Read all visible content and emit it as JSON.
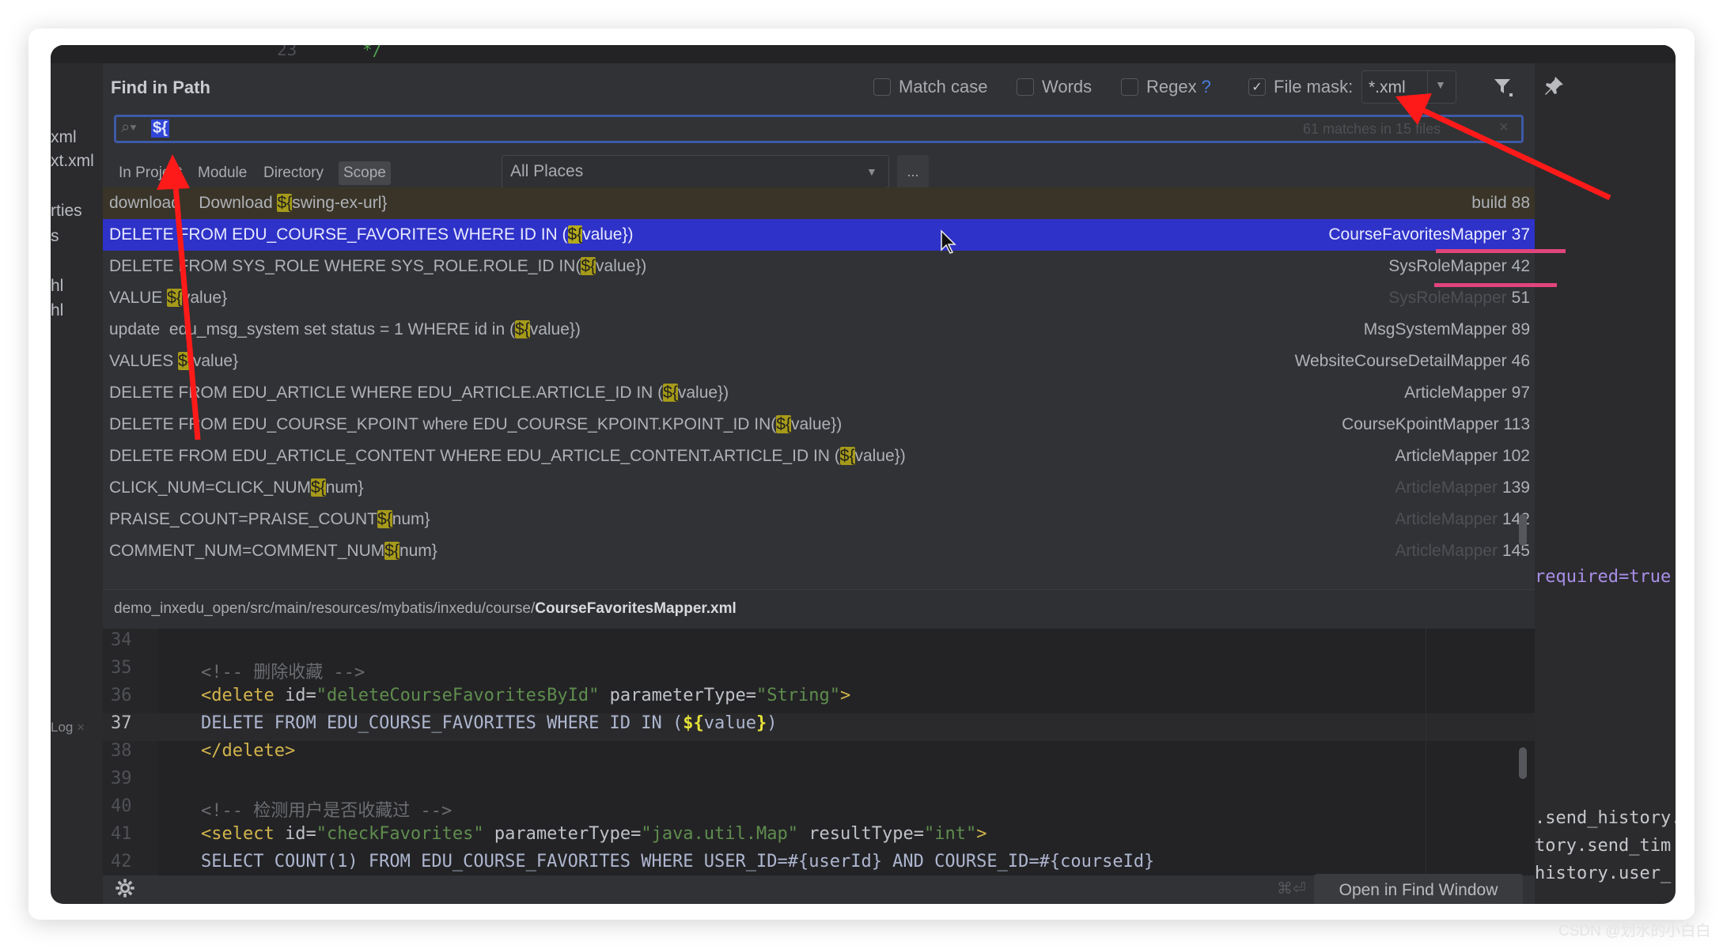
{
  "ide_background": {
    "top_line_number": "23",
    "top_code": "*/",
    "left_items": [
      "xml",
      "xt.xml",
      "rties",
      "s",
      "hl",
      "hl"
    ],
    "left_log": "Log",
    "left_log_close": "×",
    "right_lines": [
      "required=true",
      ".send_history.",
      "tory.send_tim",
      "history.user_"
    ]
  },
  "dialog": {
    "title": "Find in Path",
    "options": {
      "match_case": {
        "label": "Match case",
        "checked": false
      },
      "words": {
        "label": "Words",
        "checked": false
      },
      "regex": {
        "label": "Regex",
        "checked": false,
        "help": "?"
      },
      "file_mask": {
        "label": "File mask:",
        "checked": true,
        "value": "*.xml"
      }
    },
    "search": {
      "value": "${",
      "status": "61 matches in 15 files",
      "clear": "×"
    },
    "scope_tabs": [
      "In Project",
      "Module",
      "Directory",
      "Scope"
    ],
    "active_scope_tab": "Scope",
    "scope_select": "All Places",
    "browse_button": "...",
    "results": [
      {
        "pre": "download    Download ",
        "match": "${",
        "post": "swing-ex-url}",
        "file": "build",
        "line": "88",
        "dim": false
      },
      {
        "pre": "DELETE FROM EDU_COURSE_FAVORITES WHERE ID IN (",
        "match": "${",
        "post": "value})",
        "file": "CourseFavoritesMapper",
        "line": "37",
        "dim": false,
        "selected": true
      },
      {
        "pre": "DELETE FROM SYS_ROLE WHERE SYS_ROLE.ROLE_ID IN(",
        "match": "${",
        "post": "value})",
        "file": "SysRoleMapper",
        "line": "42",
        "dim": false
      },
      {
        "pre": "VALUE ",
        "match": "${",
        "post": "value}",
        "file": "SysRoleMapper",
        "line": "51",
        "dim": true
      },
      {
        "pre": "update  edu_msg_system set status = 1 WHERE id in (",
        "match": "${",
        "post": "value})",
        "file": "MsgSystemMapper",
        "line": "89",
        "dim": false
      },
      {
        "pre": "VALUES ",
        "match": "${",
        "post": "value}",
        "file": "WebsiteCourseDetailMapper",
        "line": "46",
        "dim": false
      },
      {
        "pre": "DELETE FROM EDU_ARTICLE WHERE EDU_ARTICLE.ARTICLE_ID IN (",
        "match": "${",
        "post": "value})",
        "file": "ArticleMapper",
        "line": "97",
        "dim": false
      },
      {
        "pre": "DELETE FROM EDU_COURSE_KPOINT where EDU_COURSE_KPOINT.KPOINT_ID IN(",
        "match": "${",
        "post": "value})",
        "file": "CourseKpointMapper",
        "line": "113",
        "dim": false
      },
      {
        "pre": "DELETE FROM EDU_ARTICLE_CONTENT WHERE EDU_ARTICLE_CONTENT.ARTICLE_ID IN (",
        "match": "${",
        "post": "value})",
        "file": "ArticleMapper",
        "line": "102",
        "dim": false
      },
      {
        "pre": "CLICK_NUM=CLICK_NUM",
        "match": "${",
        "post": "num}",
        "file": "ArticleMapper",
        "line": "139",
        "dim": true
      },
      {
        "pre": "PRAISE_COUNT=PRAISE_COUNT",
        "match": "${",
        "post": "num}",
        "file": "ArticleMapper",
        "line": "142",
        "dim": true
      },
      {
        "pre": "COMMENT_NUM=COMMENT_NUM",
        "match": "${",
        "post": "num}",
        "file": "ArticleMapper",
        "line": "145",
        "dim": true
      }
    ],
    "path": {
      "dir": "demo_inxedu_open/src/main/resources/mybatis/inxedu/course/",
      "file": "CourseFavoritesMapper.xml"
    },
    "preview": {
      "current_line": "37",
      "lines": [
        {
          "n": "34",
          "tokens": []
        },
        {
          "n": "35",
          "tokens": [
            {
              "t": "<!-- 删除收藏 -->",
              "k": "cmt"
            }
          ]
        },
        {
          "n": "36",
          "tokens": [
            {
              "t": "<delete ",
              "k": "tag"
            },
            {
              "t": "id=",
              "k": "attr"
            },
            {
              "t": "\"deleteCourseFavoritesById\"",
              "k": "str"
            },
            {
              "t": " parameterType=",
              "k": "attr"
            },
            {
              "t": "\"String\"",
              "k": "str"
            },
            {
              "t": ">",
              "k": "tag"
            }
          ]
        },
        {
          "n": "37",
          "tokens": [
            {
              "t": "DELETE FROM EDU_COURSE_FAVORITES WHERE ID IN (",
              "k": "txt"
            },
            {
              "t": "${",
              "k": "dollar"
            },
            {
              "t": "value",
              "k": "txt"
            },
            {
              "t": "}",
              "k": "dollar"
            },
            {
              "t": ")",
              "k": "txt"
            }
          ]
        },
        {
          "n": "38",
          "tokens": [
            {
              "t": "</delete>",
              "k": "tag"
            }
          ]
        },
        {
          "n": "39",
          "tokens": []
        },
        {
          "n": "40",
          "tokens": [
            {
              "t": "<!-- 检测用户是否收藏过 -->",
              "k": "cmt"
            }
          ]
        },
        {
          "n": "41",
          "tokens": [
            {
              "t": "<select ",
              "k": "tag"
            },
            {
              "t": "id=",
              "k": "attr"
            },
            {
              "t": "\"checkFavorites\"",
              "k": "str"
            },
            {
              "t": " parameterType=",
              "k": "attr"
            },
            {
              "t": "\"java.util.Map\"",
              "k": "str"
            },
            {
              "t": " resultType=",
              "k": "attr"
            },
            {
              "t": "\"int\"",
              "k": "str"
            },
            {
              "t": ">",
              "k": "tag"
            }
          ]
        },
        {
          "n": "42",
          "tokens": [
            {
              "t": "SELECT COUNT(1) FROM EDU_COURSE_FAVORITES WHERE USER_ID=#{userId} AND COURSE_ID=#{courseId}",
              "k": "txt"
            }
          ]
        }
      ]
    },
    "shortcut_hint": "⌘⏎",
    "open_in_find_window": "Open in Find Window"
  },
  "watermark": "CSDN @划水的小白白",
  "colors": {
    "selection": "#2e32c8",
    "match_highlight": "#a69a1a",
    "annotation_arrow": "#ff1a1a",
    "annotation_underline": "#e0457b",
    "accent": "#3d5aa8"
  },
  "icons": {
    "search": "search-icon",
    "filter": "filter-icon",
    "pin": "pin-icon",
    "settings": "gear-icon",
    "dropdown": "chevron-down-icon"
  }
}
